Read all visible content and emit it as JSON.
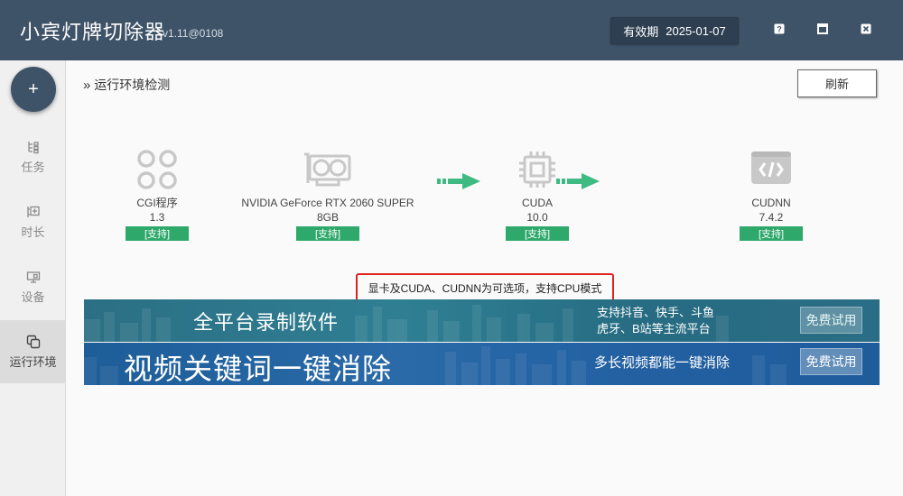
{
  "app": {
    "title": "小宾灯牌切除器",
    "version": "v1.11@0108",
    "expiry_label": "有效期",
    "expiry_date": "2025-01-07"
  },
  "window_controls": {
    "help_icon": "question-icon",
    "maximize_icon": "maximize-icon",
    "close_icon": "close-icon"
  },
  "sidebar": {
    "add_label": "+",
    "items": [
      {
        "label": "任务",
        "icon": "task-icon",
        "active": false
      },
      {
        "label": "时长",
        "icon": "duration-icon",
        "active": false
      },
      {
        "label": "设备",
        "icon": "device-icon",
        "active": false
      },
      {
        "label": "运行环境",
        "icon": "environment-icon",
        "active": true
      }
    ]
  },
  "main": {
    "section_title": "运行环境检测",
    "refresh_label": "刷新",
    "env_items": [
      {
        "name": "CGI程序",
        "version": "1.3",
        "status": "[支持]",
        "icon": "clover-icon"
      },
      {
        "name": "NVIDIA GeForce RTX 2060 SUPER",
        "version": "8GB",
        "status": "[支持]",
        "icon": "gpu-icon"
      },
      {
        "name": "CUDA",
        "version": "10.0",
        "status": "[支持]",
        "icon": "chip-icon"
      },
      {
        "name": "CUDNN",
        "version": "7.4.2",
        "status": "[支持]",
        "icon": "code-icon"
      }
    ],
    "note": "显卡及CUDA、CUDNN为可选项，支持CPU模式"
  },
  "banners": [
    {
      "title": "全平台录制软件",
      "sub_line1": "支持抖音、快手、斗鱼",
      "sub_line2": "虎牙、B站等主流平台",
      "button": "免费试用"
    },
    {
      "title": "视频关键词一键消除",
      "sub_line1": "多长视频都能一键消除",
      "button": "免费试用"
    }
  ],
  "colors": {
    "titlebar": "#3f5368",
    "badge_green": "#2ea86b",
    "note_border": "#e02020"
  }
}
